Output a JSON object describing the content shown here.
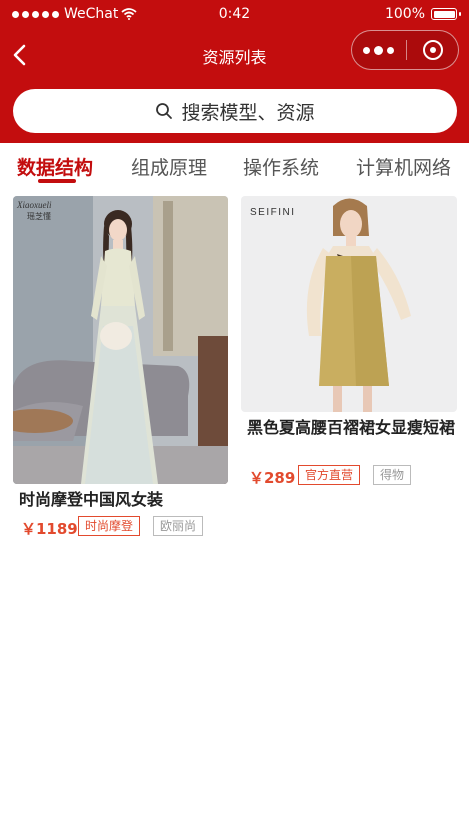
{
  "status_bar": {
    "carrier": "WeChat",
    "time": "0:42",
    "battery": "100%"
  },
  "nav": {
    "title": "资源列表"
  },
  "search": {
    "placeholder": "搜索模型、资源"
  },
  "tabs": [
    {
      "label": "数据结构",
      "active": true
    },
    {
      "label": "组成原理",
      "active": false
    },
    {
      "label": "操作系统",
      "active": false
    },
    {
      "label": "计算机网络",
      "active": false
    }
  ],
  "products": [
    {
      "title": "时尚摩登中国风女装",
      "price": "￥1189",
      "tag_primary": "时尚摩登",
      "tag_secondary": "欧丽尚",
      "image_brand": "Xiaoxueli 瑶芝懂"
    },
    {
      "title": "黑色夏高腰百褶裙女显瘦短裙",
      "price": "￥289",
      "tag_primary": "官方直营",
      "tag_secondary": "得物",
      "image_brand": "SEIFINI"
    }
  ],
  "colors": {
    "brand_red": "#c30d0e",
    "price_red": "#e24a2e"
  }
}
